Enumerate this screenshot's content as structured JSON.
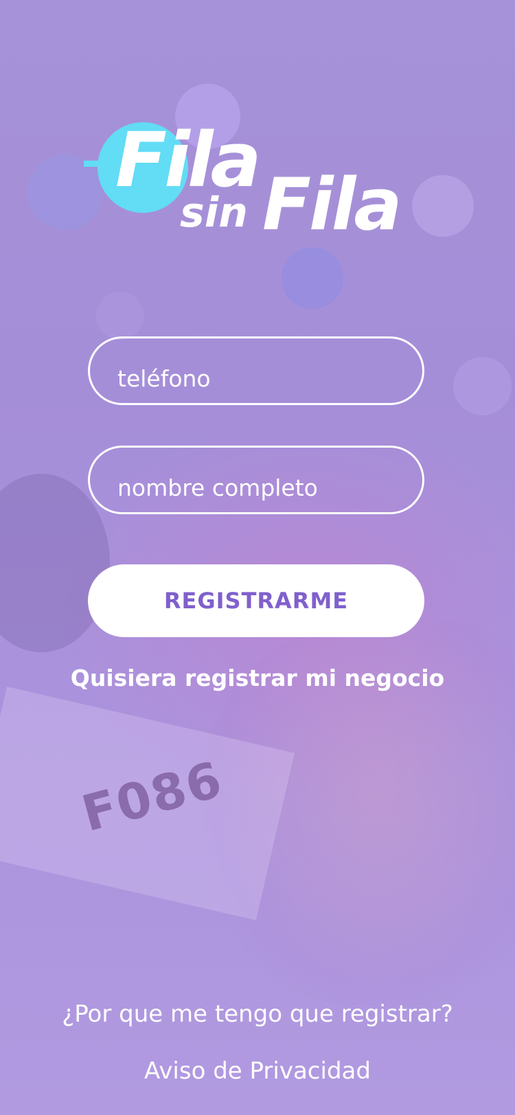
{
  "logo": {
    "line1": "Fila",
    "line2_small": "sin",
    "line2_big": "Fila",
    "accent_color": "#63dcf5"
  },
  "form": {
    "phone_placeholder": "teléfono",
    "name_placeholder": "nombre completo",
    "register_label": "REGISTRARME"
  },
  "links": {
    "business": "Quisiera registrar mi negocio",
    "why_register": "¿Por que me tengo que registrar?",
    "privacy": "Aviso de Privacidad"
  },
  "background": {
    "ticket_text": "F086"
  },
  "colors": {
    "primary_purple": "#a592d8",
    "button_text": "#8060cc",
    "white": "#ffffff"
  }
}
